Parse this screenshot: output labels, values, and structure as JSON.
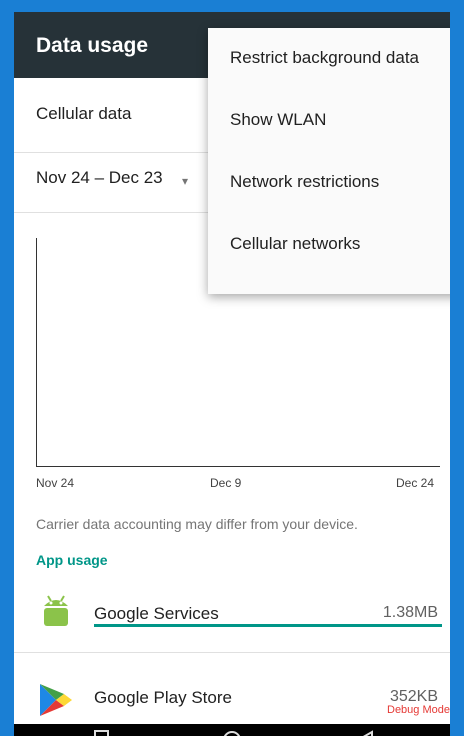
{
  "header": {
    "title": "Data usage"
  },
  "data_source": {
    "label": "Cellular data"
  },
  "cycle": {
    "label": "Nov 24 – Dec 23",
    "arrow": "▾"
  },
  "graph": {
    "x_labels": [
      "Nov 24",
      "Dec 9",
      "Dec 24"
    ]
  },
  "note": "Carrier data accounting may differ from your device.",
  "app_usage": {
    "title": "App usage",
    "apps": [
      {
        "name": "Google Services",
        "size": "1.38MB",
        "icon": "android-icon",
        "usage_fraction": 1.0
      },
      {
        "name": "Google Play Store",
        "size": "352KB",
        "icon": "play-store-icon"
      }
    ]
  },
  "debug_text": "Debug Mode",
  "menu": {
    "items": [
      "Restrict background data",
      "Show WLAN",
      "Network restrictions",
      "Cellular networks"
    ]
  },
  "navbar": {
    "recents_icon": "square-icon",
    "home_icon": "circle-icon",
    "back_icon": "triangle-icon"
  },
  "colors": {
    "appbar": "#263238",
    "accent": "#009688",
    "frame": "#1a7fd4"
  }
}
